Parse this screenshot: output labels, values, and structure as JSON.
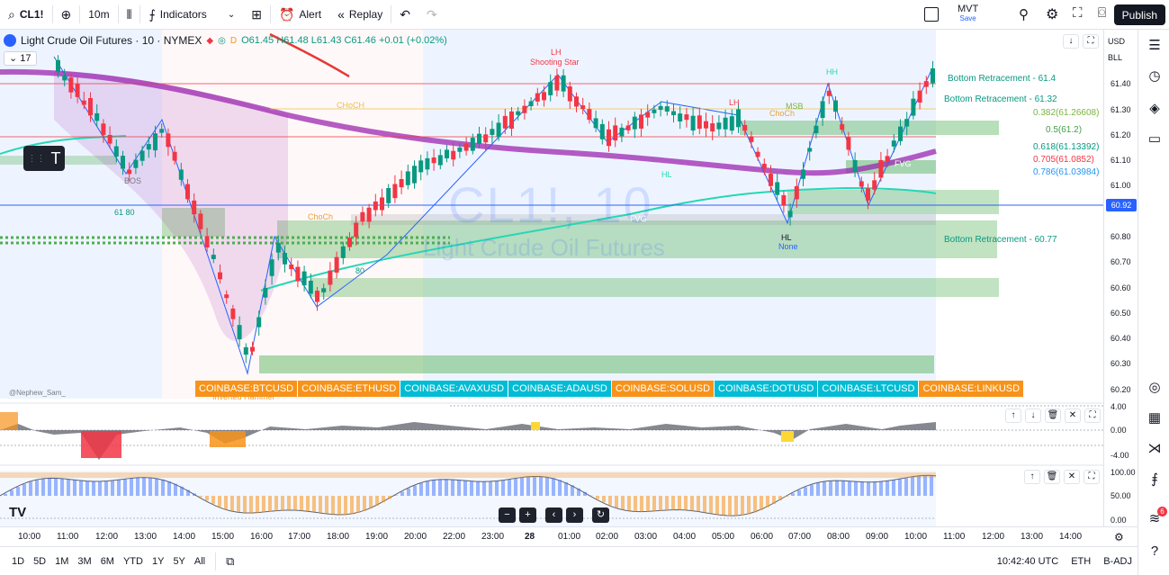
{
  "toolbar": {
    "symbol": "CL1!",
    "interval": "10m",
    "indicators_label": "Indicators",
    "alert_label": "Alert",
    "replay_label": "Replay",
    "layout_name": "MVT",
    "layout_status": "Save",
    "publish_label": "Publish"
  },
  "legend": {
    "title": "Light Crude Oil Futures · 10 · NYMEX",
    "ohlc": "O61.45 H61.48 L61.43 C61.46 +0.01 (+0.02%)",
    "indicator_count": "17"
  },
  "watermark": {
    "symbol": "CL1!, 10",
    "description": "Light Crude Oil Futures"
  },
  "chart_labels": {
    "shooting_star": "Shooting Star",
    "lh": "LH",
    "lh2": "LH",
    "hh": "HH",
    "hl": "HL",
    "hl2": "HL",
    "none": "None",
    "fvg": "FVG",
    "fvg2": "FVG",
    "choch": "ChoCh",
    "choch2": "ChoCh",
    "choch3": "CHoCH",
    "msb": "MSB",
    "bos": "BOS",
    "inverted_hammer": "Inverted Hammer",
    "ret1": "Bottom Retracement - 61.4",
    "ret2": "Bottom Retracement - 61.32",
    "ret3": "Bottom Retracement - 60.77",
    "fib1": "0.382(61.26608)",
    "fib2": "0.5(61.2)",
    "fib3": "0.618(61.13392)",
    "fib4": "0.705(61.0852)",
    "fib5": "0.786(61.03984)",
    "user": "@Nephew_Sam_",
    "fib_left": "61 80",
    "fib_left2": "80"
  },
  "tickers": [
    {
      "label": "COINBASE:BTCUSD",
      "color": "orange"
    },
    {
      "label": "COINBASE:ETHUSD",
      "color": "orange"
    },
    {
      "label": "COINBASE:AVAXUSD",
      "color": "teal"
    },
    {
      "label": "COINBASE:ADAUSD",
      "color": "teal"
    },
    {
      "label": "COINBASE:SOLUSD",
      "color": "orange"
    },
    {
      "label": "COINBASE:DOTUSD",
      "color": "teal"
    },
    {
      "label": "COINBASE:LTCUSD",
      "color": "teal"
    },
    {
      "label": "COINBASE:LINKUSD",
      "color": "orange"
    }
  ],
  "price_axis": {
    "currency": "USD",
    "unit": "BLL",
    "ticks": [
      "61.40",
      "61.30",
      "61.20",
      "61.10",
      "61.00",
      "60.80",
      "60.70",
      "60.60",
      "60.50",
      "60.40",
      "60.30",
      "60.20"
    ],
    "current_price": "60.92",
    "osc1_ticks": [
      "4.00",
      "0.00",
      "-4.00"
    ],
    "osc2_ticks": [
      "100.00",
      "50.00",
      "0.00"
    ]
  },
  "time_axis": {
    "ticks": [
      "10:00",
      "11:00",
      "12:00",
      "13:00",
      "14:00",
      "15:00",
      "16:00",
      "17:00",
      "18:00",
      "19:00",
      "20:00",
      "22:00",
      "23:00",
      "28",
      "01:00",
      "02:00",
      "03:00",
      "04:00",
      "05:00",
      "06:00",
      "07:00",
      "08:00",
      "09:00",
      "10:00",
      "11:00",
      "12:00",
      "13:00",
      "14:00"
    ]
  },
  "bottombar": {
    "ranges": [
      "1D",
      "5D",
      "1M",
      "3M",
      "6M",
      "YTD",
      "1Y",
      "5Y",
      "All"
    ],
    "clock": "10:42:40 UTC",
    "session": "ETH",
    "adjust": "B-ADJ"
  },
  "colors": {
    "up": "#089981",
    "down": "#f23645",
    "accent": "#2962ff",
    "cloud": "#9c27b0",
    "zone": "#4caf50"
  }
}
